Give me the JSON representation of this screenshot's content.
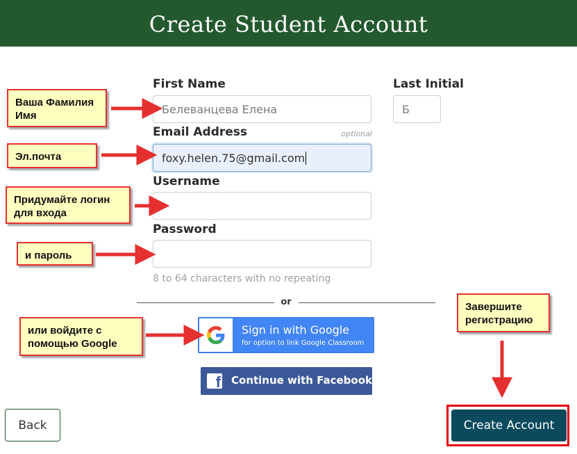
{
  "header": {
    "title": "Create Student Account"
  },
  "form": {
    "first_name": {
      "label": "First Name",
      "value": "Белеванцева Елена"
    },
    "last_initial": {
      "label": "Last Initial",
      "value": "Б"
    },
    "email": {
      "label": "Email Address",
      "optional_tag": "optional",
      "value": "foxy.helen.75@gmail.com"
    },
    "username": {
      "label": "Username",
      "value": ""
    },
    "password": {
      "label": "Password",
      "value": "",
      "hint": "8 to 64 characters with no repeating"
    }
  },
  "divider": {
    "text": "or"
  },
  "google": {
    "title": "Sign in with Google",
    "subtitle": "for option to link Google Classroom",
    "icon": "google-g-icon"
  },
  "facebook": {
    "label": "Continue with Facebook",
    "icon": "facebook-f-icon"
  },
  "footer": {
    "back_label": "Back",
    "create_label": "Create Account"
  },
  "annotations": {
    "name": "Ваша Фамилия Имя",
    "email": "Эл.почта",
    "login": "Придумайте логин для входа",
    "password": "и пароль",
    "google": "или войдите  с помощью Google",
    "finish": "Завершите регистрацию"
  },
  "colors": {
    "header_bg": "#24592f",
    "primary_button": "#0b4a5c",
    "google_blue": "#4285f4",
    "facebook_blue": "#3b5998",
    "annotation_red": "#e53030",
    "annotation_bg": "#ffffc0"
  }
}
